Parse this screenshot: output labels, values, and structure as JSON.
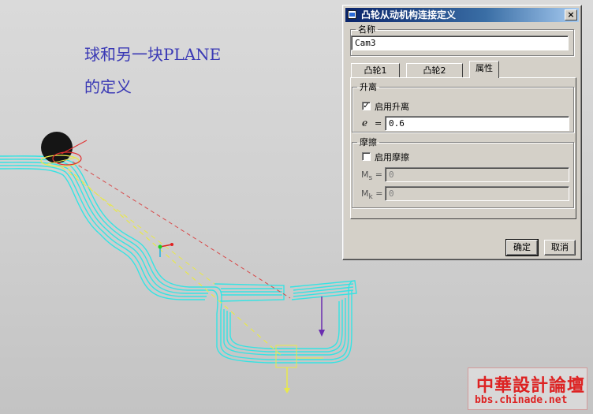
{
  "viewport": {
    "annotation_line1": "球和另一块PLANE",
    "annotation_line2": "的定义"
  },
  "dialog": {
    "title": "凸轮从动机构连接定义",
    "close_glyph": "×",
    "name_group_label": "名称",
    "name_value": "Cam3",
    "tabs": [
      {
        "label": "凸轮1",
        "active": false
      },
      {
        "label": "凸轮2",
        "active": false
      },
      {
        "label": "属性",
        "active": true
      }
    ],
    "liftoff": {
      "group_label": "升离",
      "enable_label": "启用升离",
      "enabled": true,
      "e_symbol": "e",
      "e_equals": "=",
      "e_value": "0.6"
    },
    "friction": {
      "group_label": "摩擦",
      "enable_label": "启用摩擦",
      "enabled": false,
      "ms_symbol": "M",
      "ms_sub": "s",
      "ms_equals": "=",
      "ms_value": "0",
      "mk_symbol": "M",
      "mk_sub": "k",
      "mk_equals": "=",
      "mk_value": "0"
    },
    "ok_label": "确定",
    "cancel_label": "取消"
  },
  "watermark": {
    "site_name": "中華設計論壇",
    "url": "bbs.chinade.net"
  },
  "colors": {
    "track": "#35e3e3",
    "ball": "#151515",
    "annotation": "#3a39b5",
    "dialog_bg": "#d4d0c8",
    "title_bar": "#0a246a",
    "watermark": "#dd2222"
  }
}
